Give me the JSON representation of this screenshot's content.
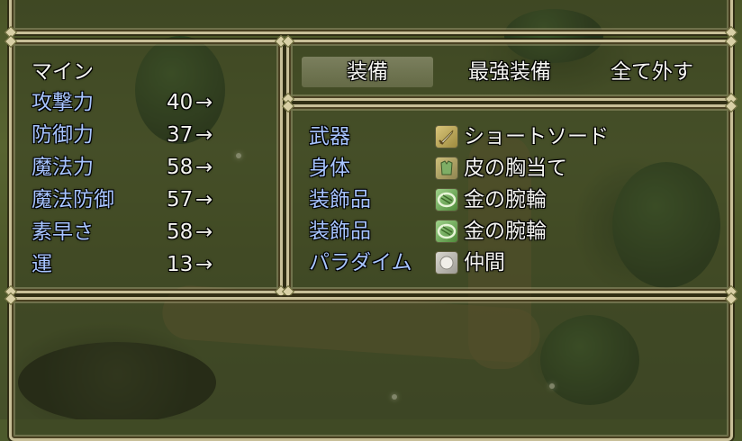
{
  "status": {
    "actor_name": "マイン",
    "stats": [
      {
        "label": "攻撃力",
        "value": "40",
        "arrow": "→"
      },
      {
        "label": "防御力",
        "value": "37",
        "arrow": "→"
      },
      {
        "label": "魔法力",
        "value": "58",
        "arrow": "→"
      },
      {
        "label": "魔法防御",
        "value": "57",
        "arrow": "→"
      },
      {
        "label": "素早さ",
        "value": "58",
        "arrow": "→"
      },
      {
        "label": "運",
        "value": "13",
        "arrow": "→"
      }
    ]
  },
  "commands": [
    {
      "label": "装備",
      "selected": true
    },
    {
      "label": "最強装備",
      "selected": false
    },
    {
      "label": "全て外す",
      "selected": false
    }
  ],
  "equipment": [
    {
      "slot": "武器",
      "icon": "sword-icon",
      "item": "ショートソード"
    },
    {
      "slot": "身体",
      "icon": "armor-icon",
      "item": "皮の胸当て"
    },
    {
      "slot": "装飾品",
      "icon": "bracelet-icon",
      "item": "金の腕輪"
    },
    {
      "slot": "装飾品",
      "icon": "bracelet-icon",
      "item": "金の腕輪"
    },
    {
      "slot": "パラダイム",
      "icon": "paradigm-icon",
      "item": "仲間"
    }
  ],
  "colors": {
    "system_blue": "#a7c4ff",
    "normal_white": "#f4f4f0",
    "frame": "#c8bf98"
  }
}
